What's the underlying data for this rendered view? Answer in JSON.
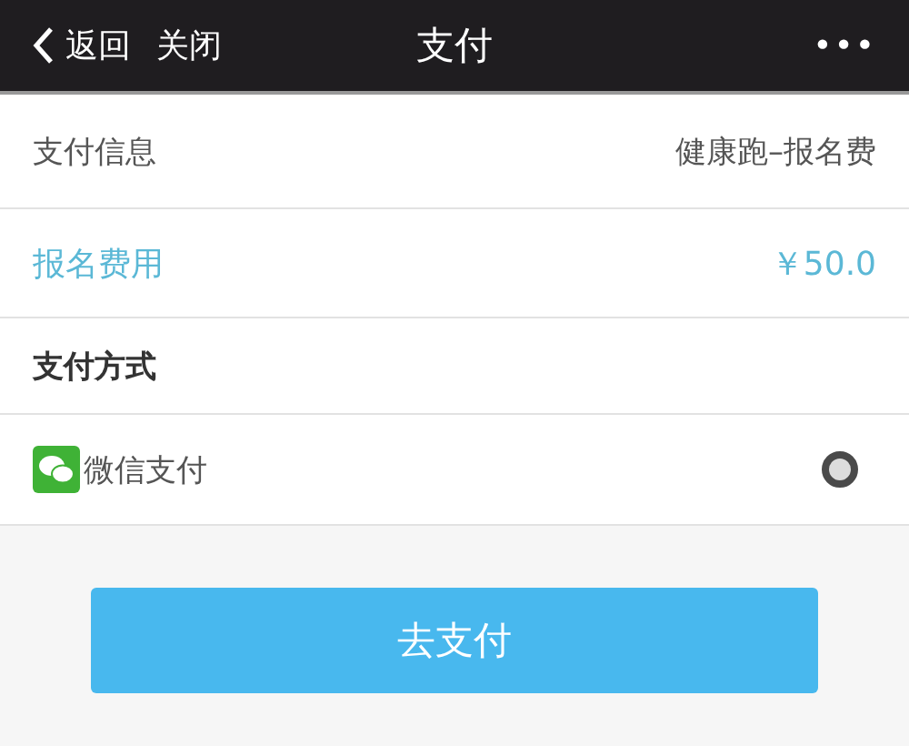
{
  "nav_bar": {
    "back": "返回",
    "close": "关闭",
    "title": "支付",
    "more": "•••"
  },
  "rows": [
    {
      "kind": "info",
      "label": "支付信息",
      "value": "健康跑–报名费"
    },
    {
      "kind": "price",
      "label": "报名费用",
      "value": "￥50.0"
    },
    {
      "kind": "heading",
      "label": "支付方式"
    }
  ],
  "payment_methods": [
    {
      "label": "微信支付",
      "selected": true
    }
  ],
  "pay_button": "去支付"
}
